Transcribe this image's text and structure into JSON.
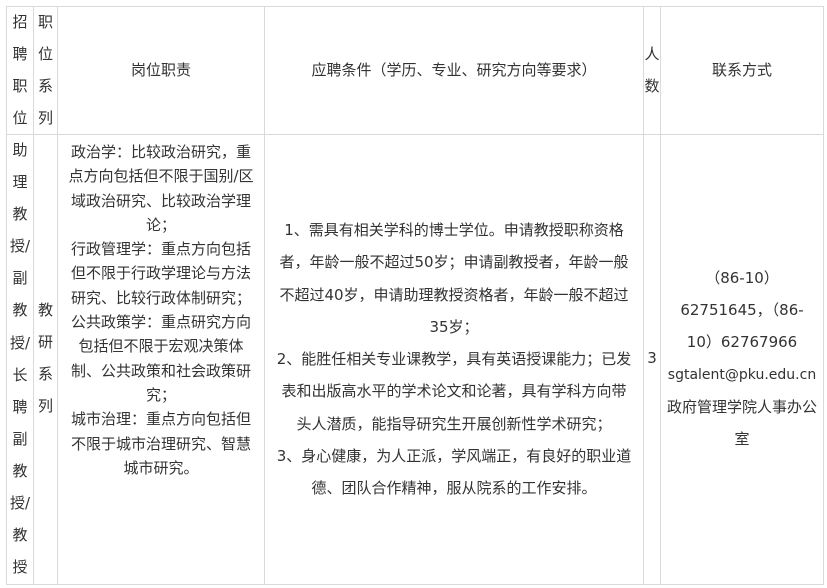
{
  "header": {
    "position_chars": [
      "招",
      "聘",
      "职",
      "位"
    ],
    "series_chars": [
      "职",
      "位",
      "系",
      "列"
    ],
    "duties": "岗位职责",
    "requirements": "应聘条件（学历、专业、研究方向等要求）",
    "count_chars": [
      "人",
      "数"
    ],
    "contact": "联系方式"
  },
  "row": {
    "position_chars": [
      "助",
      "理",
      "教",
      "授/",
      "副",
      "教",
      "授/",
      "长",
      "聘",
      "副",
      "教",
      "授/",
      "教",
      "授"
    ],
    "series_chars": [
      "教",
      "研",
      "系",
      "列"
    ],
    "duties_paragraphs": [
      {
        "label": "政治学",
        "lines": [
          "政治学：比较政治研究，重",
          "点方向包括但不限于国别/区",
          "域政治研究、比较政治学理",
          "论；"
        ]
      },
      {
        "label": "行政管理学",
        "lines": [
          "行政管理学：重点方向包括",
          "但不限于行政学理论与方法",
          "研究、比较行政体制研究；"
        ]
      },
      {
        "label": "公共政策学",
        "lines": [
          "公共政策学：重点研究方向",
          "包括但不限于宏观决策体",
          "制、公共政策和社会政策研",
          "究；"
        ]
      },
      {
        "label": "城市治理",
        "lines": [
          "城市治理：重点方向包括但",
          "不限于城市治理研究、智慧",
          "城市研究。"
        ]
      }
    ],
    "requirements_lines": [
      "1、需具有相关学科的博士学位。申请教授职称资格",
      "者，年龄一般不超过50岁；申请副教授者，年龄一般",
      "不超过40岁，申请助理教授资格者，年龄一般不超过",
      "35岁；",
      "2、能胜任相关专业课教学，具有英语授课能力；已发",
      "表和出版高水平的学术论文和论著，具有学科方向带",
      "头人潜质，能指导研究生开展创新性学术研究；",
      "3、身心健康，为人正派，学风端正，有良好的职业道",
      "德、团队合作精神，服从院系的工作安排。"
    ],
    "count": "3",
    "contact_lines": [
      "（86-10）",
      "62751645，（86-",
      "10）62767966",
      "sgtalent@pku.edu.cn",
      "政府管理学院人事办公",
      "室"
    ]
  }
}
